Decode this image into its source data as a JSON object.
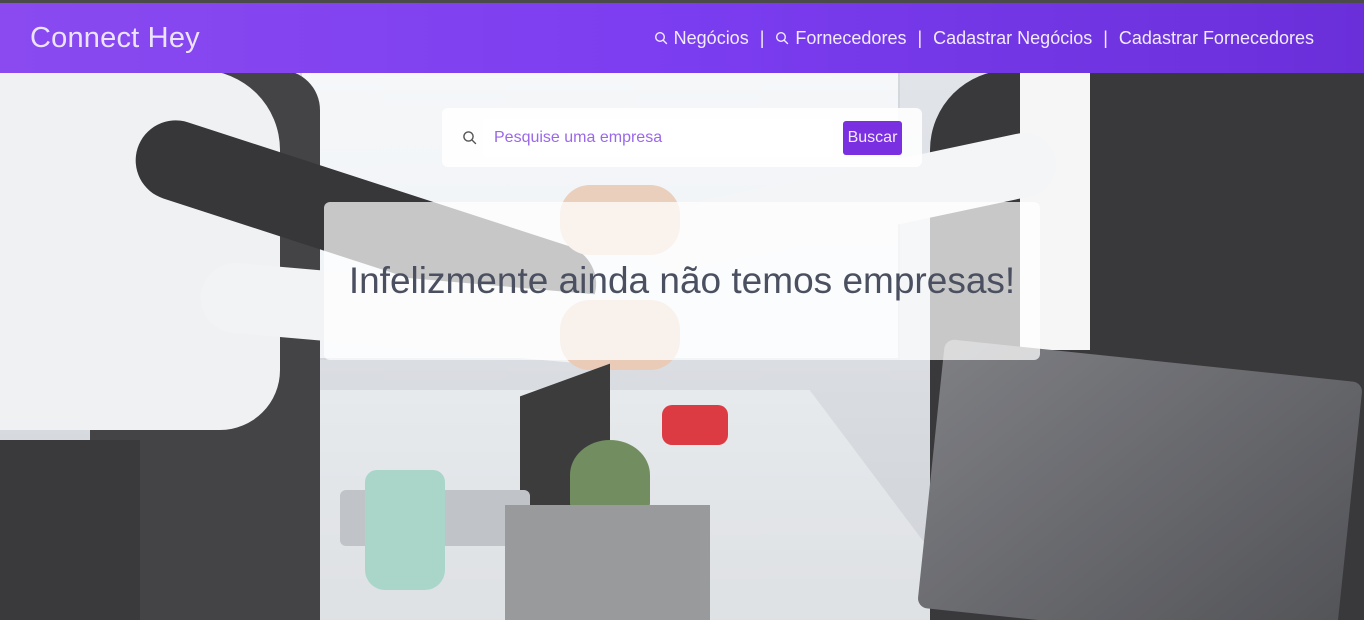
{
  "navbar": {
    "brand": "Connect Hey",
    "links": [
      {
        "label": "Negócios",
        "icon": "search-icon"
      },
      {
        "label": "Fornecedores",
        "icon": "search-icon"
      },
      {
        "label": "Cadastrar Negócios"
      },
      {
        "label": "Cadastrar Fornecedores"
      }
    ],
    "separator": "|"
  },
  "search": {
    "placeholder": "Pesquise uma empresa",
    "value": "",
    "button_label": "Buscar",
    "icon": "search-icon"
  },
  "message": {
    "text": "Infelizmente ainda não temos empresas!"
  },
  "colors": {
    "navbar": "#7b3df0",
    "button": "#7a2fe0",
    "placeholder": "#9a68e8",
    "message_text": "#4b5060"
  }
}
